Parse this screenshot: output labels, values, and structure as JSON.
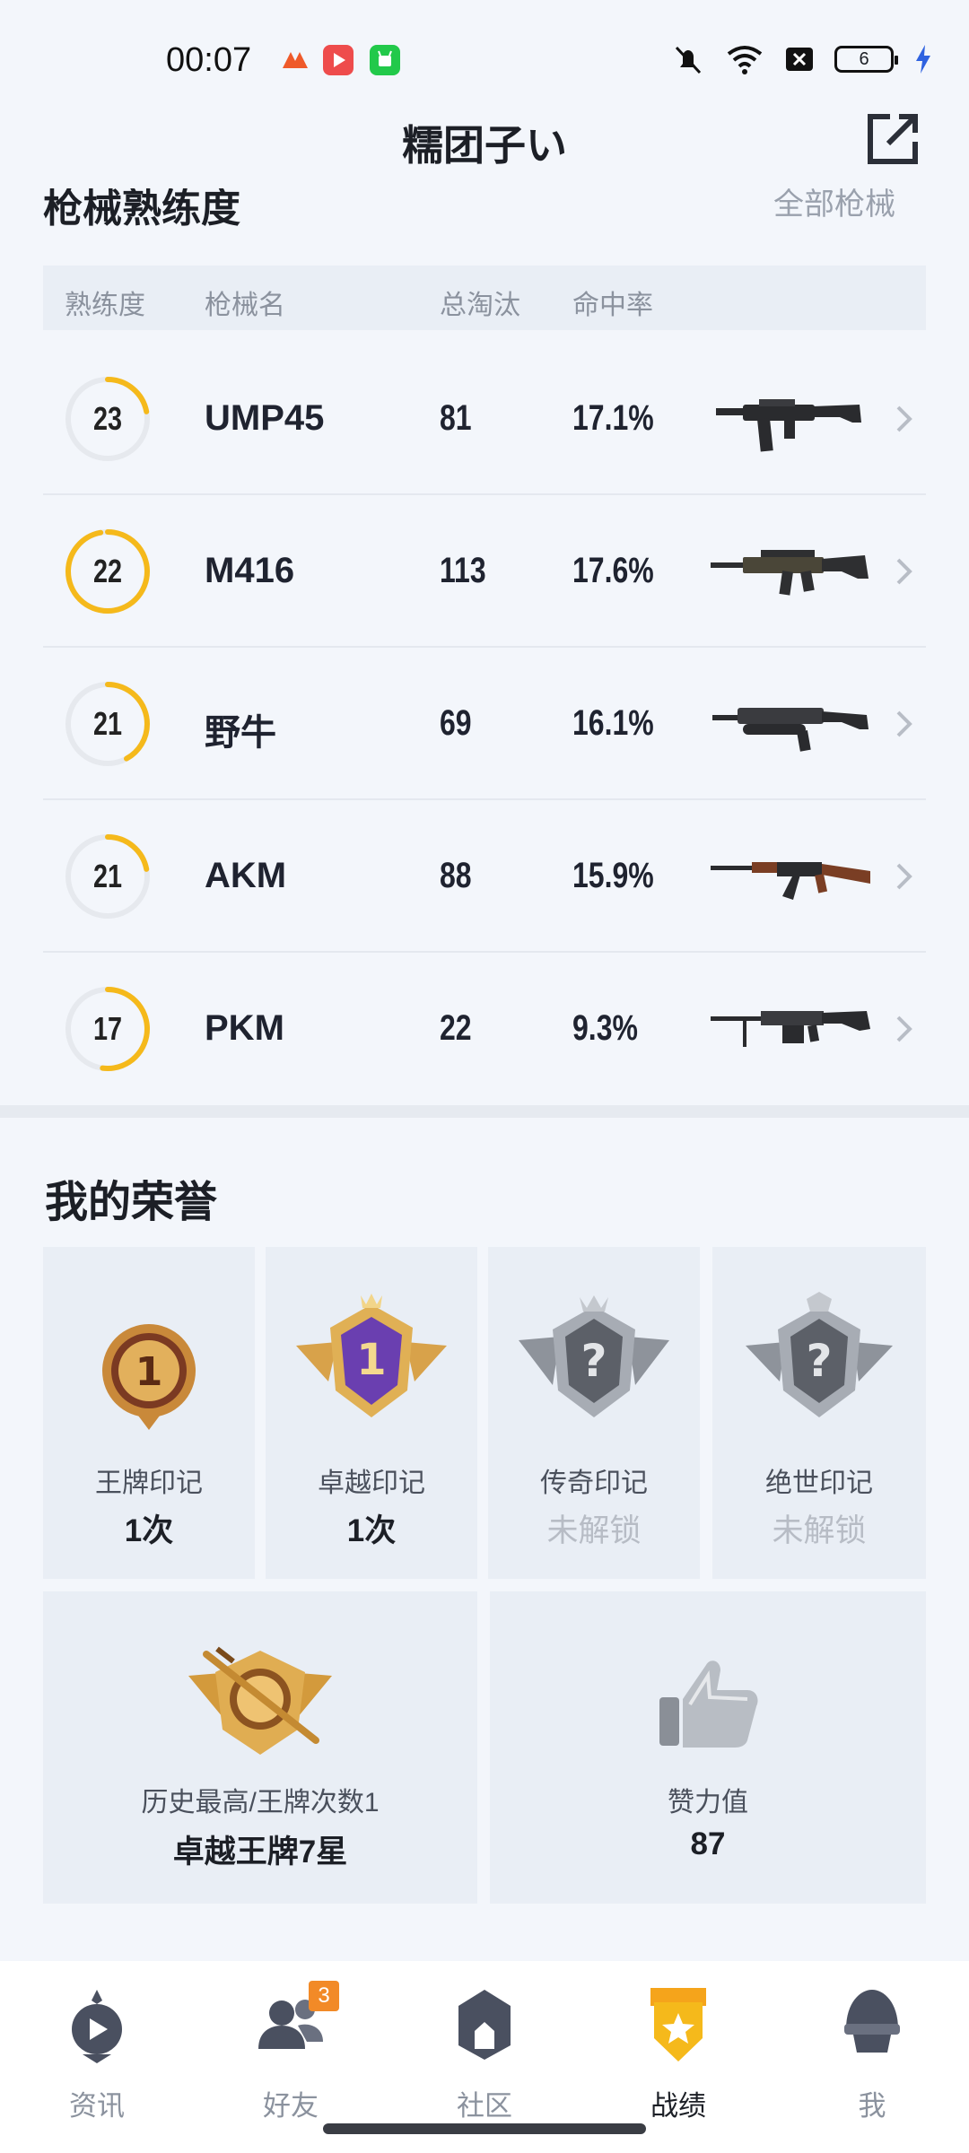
{
  "status_bar": {
    "time": "00:07",
    "battery": "6"
  },
  "header": {
    "title": "糯团子い"
  },
  "weapon_section": {
    "title": "枪械熟练度",
    "all_link": "全部枪械",
    "columns": [
      "熟练度",
      "枪械名",
      "总淘汰",
      "命中率"
    ],
    "rows": [
      {
        "level": "23",
        "progress": 0.22,
        "name": "UMP45",
        "kills": "81",
        "accuracy": "17.1%"
      },
      {
        "level": "22",
        "progress": 0.97,
        "name": "M416",
        "kills": "113",
        "accuracy": "17.6%"
      },
      {
        "level": "21",
        "progress": 0.42,
        "name": "野牛",
        "kills": "69",
        "accuracy": "16.1%"
      },
      {
        "level": "21",
        "progress": 0.22,
        "name": "AKM",
        "kills": "88",
        "accuracy": "15.9%"
      },
      {
        "level": "17",
        "progress": 0.52,
        "name": "PKM",
        "kills": "22",
        "accuracy": "9.3%"
      }
    ]
  },
  "honor_section": {
    "title": "我的荣誉",
    "cards": [
      {
        "label": "王牌印记",
        "value": "1次",
        "locked": false,
        "emblem": "ace-medal-icon"
      },
      {
        "label": "卓越印记",
        "value": "1次",
        "locked": false,
        "emblem": "excellence-shield-icon"
      },
      {
        "label": "传奇印记",
        "value": "未解锁",
        "locked": true,
        "emblem": "legend-locked-icon"
      },
      {
        "label": "绝世印记",
        "value": "未解锁",
        "locked": true,
        "emblem": "peerless-locked-icon"
      }
    ],
    "best": {
      "label": "历史最高/王牌次数1",
      "value": "卓越王牌7星"
    },
    "likes": {
      "label": "赞力值",
      "value": "87"
    }
  },
  "bottom_nav": {
    "items": [
      {
        "label": "资讯",
        "icon": "news-icon",
        "active": false
      },
      {
        "label": "好友",
        "icon": "friends-icon",
        "active": false,
        "badge": "3"
      },
      {
        "label": "社区",
        "icon": "community-icon",
        "active": false
      },
      {
        "label": "战绩",
        "icon": "record-icon",
        "active": true
      },
      {
        "label": "我",
        "icon": "profile-icon",
        "active": false
      }
    ]
  },
  "colors": {
    "accent": "#f5b91b",
    "page_bg": "#f3f6fb",
    "card_bg": "#e9eef5"
  }
}
